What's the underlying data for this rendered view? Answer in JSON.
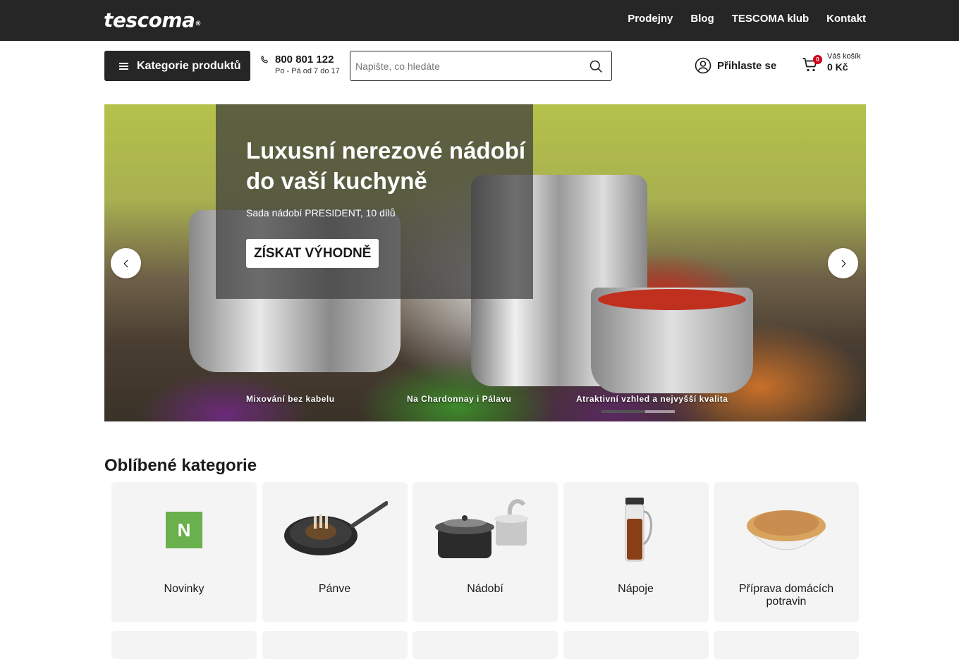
{
  "topbar": {
    "logo": "tescoma",
    "nav": [
      "Prodejny",
      "Blog",
      "TESCOMA klub",
      "Kontakt"
    ]
  },
  "header": {
    "categories_button": "Kategorie produktů",
    "phone_number": "800 801 122",
    "phone_hours": "Po - Pá od 7 do 17",
    "search_placeholder": "Napište, co hledáte",
    "login_label": "Přihlaste se",
    "cart_label": "Váš košík",
    "cart_amount": "0 Kč",
    "cart_count": "0"
  },
  "hero": {
    "title": "Luxusní nerezové nádobí do vaší kuchyně",
    "subtitle": "Sada nádobí PRESIDENT, 10 dílů",
    "cta": "ZÍSKAT VÝHODNĚ",
    "slides": [
      "Mixování bez kabelu",
      "Na Chardonnay i Pálavu",
      "Atraktivní vzhled a nejvyšší kvalita"
    ],
    "progress": 0.6
  },
  "categories": {
    "title": "Oblíbené kategorie",
    "items": [
      {
        "name": "Novinky",
        "icon": "new-badge-icon",
        "badge": "N"
      },
      {
        "name": "Pánve",
        "icon": "pan-icon"
      },
      {
        "name": "Nádobí",
        "icon": "cookware-icon"
      },
      {
        "name": "Nápoje",
        "icon": "carafe-icon"
      },
      {
        "name": "Příprava domácích potravin",
        "icon": "bread-bowl-icon"
      }
    ]
  },
  "colors": {
    "dark": "#262626",
    "badge_red": "#d0021b",
    "new_green": "#6ab04c",
    "card_bg": "#f4f4f4"
  }
}
